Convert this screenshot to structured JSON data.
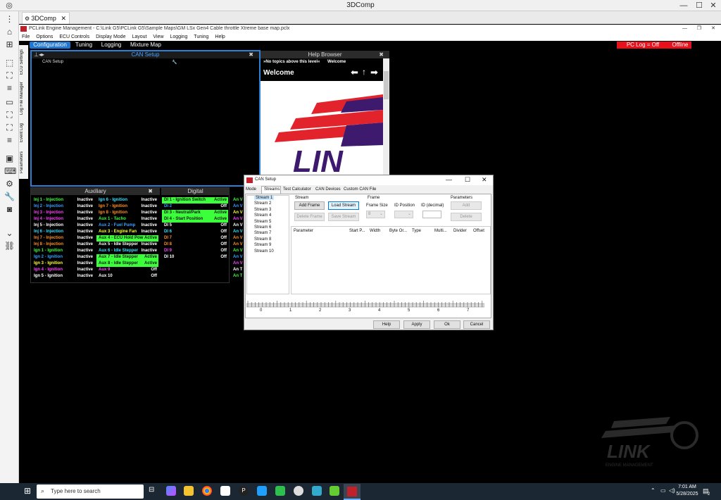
{
  "window": {
    "title": "3DComp"
  },
  "tab": {
    "label": "3DComp"
  },
  "app": {
    "title": "PCLink Engine Management - C:\\Link G5\\PCLink G5\\Sample Maps\\GM LSx Gen4 Cable throttle Xtreme base map.pclx"
  },
  "menu": [
    "File",
    "Options",
    "ECU Controls",
    "Display Mode",
    "Layout",
    "View",
    "Logging",
    "Tuning",
    "Help"
  ],
  "navtabs": [
    "Configuration",
    "Tuning",
    "Logging",
    "Mixture Map"
  ],
  "status": {
    "pclog": "PC Log = Off",
    "offline": "Offline"
  },
  "side_labels": [
    "ECU Settings",
    "Log File Manager",
    "Event Log",
    "Parameters"
  ],
  "can_panel": {
    "title": "CAN Setup",
    "item": "CAN Setup"
  },
  "help": {
    "title": "Help Browser",
    "crumb": "»No topics above this level«",
    "crumb2": "Welcome",
    "heading": "Welcome",
    "logo_text": "LIN"
  },
  "aux_title": "Auxiliary",
  "dig_title": "Digital",
  "inj_col": [
    {
      "n": "Inj 1 - Injection",
      "s": "Inactive",
      "c": "#3cff3c"
    },
    {
      "n": "Inj 2 - Injection",
      "s": "Inactive",
      "c": "#3aa0ff"
    },
    {
      "n": "Inj 3 - Injection",
      "s": "Inactive",
      "c": "#ff40ff"
    },
    {
      "n": "Inj 4 - Injection",
      "s": "Inactive",
      "c": "#ff40ff"
    },
    {
      "n": "Inj 5 - Injection",
      "s": "Inactive",
      "c": "#ffffff"
    },
    {
      "n": "Inj 6 - Injection",
      "s": "Inactive",
      "c": "#33e0ff"
    },
    {
      "n": "Inj 7 - Injection",
      "s": "Inactive",
      "c": "#ff9020"
    },
    {
      "n": "Inj 8 - Injection",
      "s": "Inactive",
      "c": "#ff9020"
    },
    {
      "n": "Ign 1 - Ignition",
      "s": "Inactive",
      "c": "#3cff3c"
    },
    {
      "n": "Ign 2 - Ignition",
      "s": "Inactive",
      "c": "#3aa0ff"
    },
    {
      "n": "Ign 3 - Ignition",
      "s": "Inactive",
      "c": "#ffff30"
    },
    {
      "n": "Ign 4 - Ignition",
      "s": "Inactive",
      "c": "#ff40ff"
    },
    {
      "n": "Ign 5 - Ignition",
      "s": "Inactive",
      "c": "#ffffff"
    }
  ],
  "aux_col": [
    {
      "n": "Ign 6 - Ignition",
      "s": "Inactive",
      "c": "#33e0ff"
    },
    {
      "n": "Ign 7 - Ignition",
      "s": "Inactive",
      "c": "#ff9020"
    },
    {
      "n": "Ign 8 - Ignition",
      "s": "Inactive",
      "c": "#ff9020"
    },
    {
      "n": "Aux 1 - Tacho",
      "s": "Inactive",
      "c": "#3cff3c"
    },
    {
      "n": "Aux 2 - Fuel Pump",
      "s": "Inactive",
      "c": "#3aa0ff"
    },
    {
      "n": "Aux 3 - Engine Fan",
      "s": "Inactive",
      "c": "#ffff30"
    },
    {
      "n": "Aux 4 - ECU Hold Pow",
      "s": "Active",
      "c": "#111111",
      "bg": "#3cff3c"
    },
    {
      "n": "Aux 5 - Idle Stepper",
      "s": "Inactive",
      "c": "#ffffff"
    },
    {
      "n": "Aux 6 - Idle Stepper",
      "s": "Inactive",
      "c": "#33e0ff"
    },
    {
      "n": "Aux 7 - Idle Stepper",
      "s": "Active",
      "c": "#111111",
      "bg": "#3cff3c"
    },
    {
      "n": "Aux 8 - Idle Stepper",
      "s": "Active",
      "c": "#111111",
      "bg": "#3cff3c"
    },
    {
      "n": "Aux 9",
      "s": "Off",
      "c": "#ff40ff"
    },
    {
      "n": "Aux 10",
      "s": "Off",
      "c": "#ffffff"
    }
  ],
  "dig_col": [
    {
      "n": "DI 1 - Ignition Switch",
      "s": "Active",
      "c": "#111111",
      "bg": "#3cff3c"
    },
    {
      "n": "DI 2",
      "s": "Off",
      "c": "#3aa0ff"
    },
    {
      "n": "DI 3 - Neutral/Park",
      "s": "Active",
      "c": "#111111",
      "bg": "#3cff3c"
    },
    {
      "n": "DI 4 - Start Position",
      "s": "Active",
      "c": "#111111",
      "bg": "#3cff3c"
    },
    {
      "n": "DI 5",
      "s": "Off",
      "c": "#ffffff"
    },
    {
      "n": "DI 6",
      "s": "Off",
      "c": "#33e0ff"
    },
    {
      "n": "DI 7",
      "s": "Off",
      "c": "#ff9020"
    },
    {
      "n": "DI 8",
      "s": "Off",
      "c": "#ff9020"
    },
    {
      "n": "DI 9",
      "s": "Off",
      "c": "#ff40ff"
    },
    {
      "n": "DI 10",
      "s": "Off",
      "c": "#ffffff"
    }
  ],
  "an_col": [
    {
      "n": "An V",
      "c": "#3cff3c"
    },
    {
      "n": "An V",
      "c": "#3aa0ff"
    },
    {
      "n": "An V",
      "c": "#ffff30"
    },
    {
      "n": "An V",
      "c": "#ff40ff"
    },
    {
      "n": "An V",
      "c": "#ffffff"
    },
    {
      "n": "An V",
      "c": "#33e0ff"
    },
    {
      "n": "An V",
      "c": "#ff9020"
    },
    {
      "n": "An V",
      "c": "#ff9020"
    },
    {
      "n": "An V",
      "c": "#3cff3c"
    },
    {
      "n": "An V",
      "c": "#3aa0ff"
    },
    {
      "n": "An V",
      "c": "#ff40ff"
    },
    {
      "n": "An T",
      "c": "#ffffff"
    },
    {
      "n": "An T",
      "c": "#3cff3c"
    }
  ],
  "dialog": {
    "title": "CAN Setup",
    "tabs": [
      "Mode",
      "Streams",
      "Test Calculator",
      "CAN Devices",
      "Custom CAN File"
    ],
    "streams": [
      "Stream 1",
      "Stream 2",
      "Stream 3",
      "Stream 4",
      "Stream 5",
      "Stream 6",
      "Stream 7",
      "Stream 8",
      "Stream 9",
      "Stream 10"
    ],
    "stream_group": "Stream",
    "frame_group": "Frame",
    "params_group": "Parameters",
    "add_frame": "Add Frame",
    "load_stream": "Load Stream",
    "delete_frame": "Delete Frame",
    "save_stream": "Save Stream",
    "frame_size_lbl": "Frame Size",
    "frame_size_val": "8",
    "id_position_lbl": "ID Position",
    "id_decimal_lbl": "ID (decimal)",
    "add": "Add",
    "delete": "Delete",
    "columns": [
      "Parameter",
      "Start P...",
      "Width",
      "Byte Or...",
      "Type",
      "Multi...",
      "Divider",
      "Offset"
    ],
    "byte_labels": [
      "0",
      "1",
      "2",
      "3",
      "4",
      "5",
      "6",
      "7"
    ],
    "help": "Help",
    "apply": "Apply",
    "ok": "Ok",
    "cancel": "Cancel"
  },
  "watermark": {
    "text": "LINK",
    "sub": "ENGINE MANAGEMENT"
  },
  "taskbar": {
    "search": "Type here to search",
    "time": "7:01 AM",
    "date": "5/28/2025",
    "badge": "2"
  }
}
